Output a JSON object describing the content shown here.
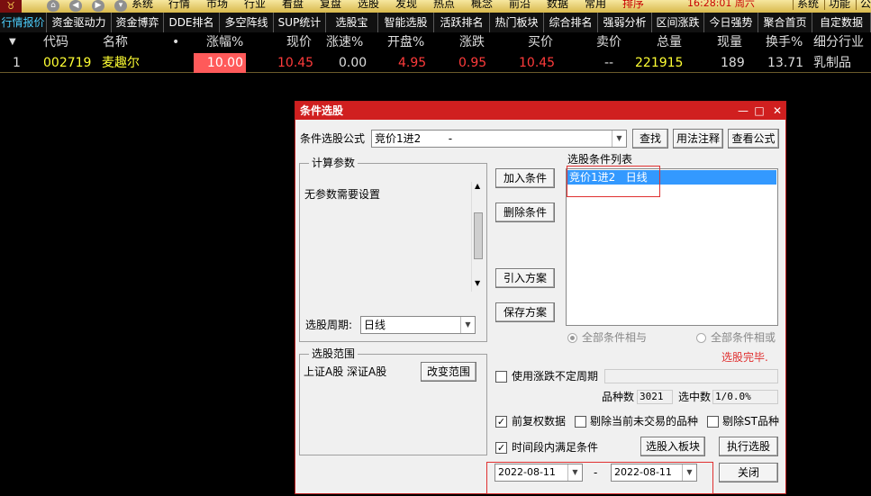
{
  "topbar": {
    "logo_icon": "bull-icon",
    "menu": [
      "系统",
      "行情",
      "市场",
      "行业",
      "看盘",
      "复盘",
      "选股",
      "发现",
      "热点",
      "概念",
      "前沿",
      "数据",
      "常用",
      "排序"
    ],
    "clock": "16:28:01 周六",
    "right": [
      "系统",
      "功能",
      "公"
    ]
  },
  "tabs": [
    "行情报价",
    "资金驱动力",
    "资金博弈",
    "DDE排名",
    "多空阵线",
    "SUP统计",
    "选股宝",
    "智能选股",
    "活跃排名",
    "热门板块",
    "综合排名",
    "强弱分析",
    "区间涨跌",
    "今日强势",
    "聚合首页",
    "自定数据"
  ],
  "columns": [
    "代码",
    "名称",
    "•",
    "涨幅%",
    "现价",
    "涨速%",
    "开盘%",
    "涨跌",
    "买价",
    "卖价",
    "总量",
    "现量",
    "换手%",
    "细分行业"
  ],
  "rows": [
    {
      "idx": "1",
      "code": "002719",
      "name": "麦趣尔",
      "change_pct": "10.00",
      "price": "10.45",
      "speed": "0.00",
      "open_pct": "4.95",
      "change": "0.95",
      "bid": "10.45",
      "ask": "--",
      "volume": "221915",
      "cur_vol": "189",
      "turnover": "13.71",
      "industry": "乳制品"
    }
  ],
  "dialog": {
    "title": "条件选股",
    "formula_label": "条件选股公式",
    "formula_value": "竞价1进2        -",
    "btn_find": "查找",
    "btn_usage": "用法注释",
    "btn_view": "查看公式",
    "params_title": "计算参数",
    "params_text": "无参数需要设置",
    "period_label": "选股周期:",
    "period_value": "日线",
    "btn_add": "加入条件",
    "btn_delete": "删除条件",
    "btn_import": "引入方案",
    "btn_save": "保存方案",
    "list_title": "选股条件列表",
    "list_items": [
      "竞价1进2   日线"
    ],
    "radio_and": "全部条件相与",
    "radio_or": "全部条件相或",
    "status": "选股完毕.",
    "range_title": "选股范围",
    "range_text": "上证A股 深证A股",
    "btn_range": "改变范围",
    "chk_period": "使用涨跌不定周期",
    "count_label": "品种数",
    "count_value": "3021",
    "selected_label": "选中数",
    "selected_value": "1/0.0%",
    "chk_fq": "前复权数据",
    "chk_exclude": "剔除当前未交易的品种",
    "chk_st": "剔除ST品种",
    "chk_interval": "时间段内满足条件",
    "btn_to_block": "选股入板块",
    "btn_execute": "执行选股",
    "date_from": "2022-08-11",
    "date_sep": "-",
    "date_to": "2022-08-11",
    "btn_close": "关闭"
  },
  "colors": {
    "accent_red": "#d01f1f",
    "limit_up_bg": "#ff5a5a",
    "up_red": "#ff3b3b",
    "green_down": "#00c000",
    "code_yellow": "#ffff33"
  }
}
